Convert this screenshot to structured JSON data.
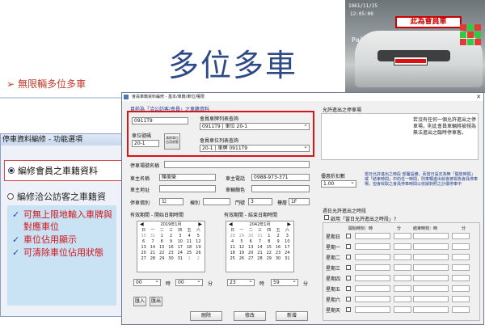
{
  "slide": {
    "title": "多位多車",
    "bullet": "無限輛多位多車"
  },
  "camera": {
    "date": "1961/11/25",
    "time": "12:05:00",
    "paid": "Paid Car",
    "badge": "此為會員車",
    "colors": {
      "grid_red": "#e53935",
      "grid_green": "#2ecc40",
      "badge_red": "#cc0000"
    }
  },
  "func_panel": {
    "title": "停車資料編修 - 功能選項",
    "option1": "編修會員之車籍資料",
    "option2": "編修洽公訪客之車籍資",
    "features": [
      "可無上限地輸入車牌與對應車位",
      "車位佔用顯示",
      "可清除車位佔用狀態"
    ]
  },
  "window": {
    "title": "會員車籍資料編修 - 基本/車籍/車位/權限",
    "close": "✕",
    "header_note": "目前為「洽公訪客/會員」之車籍資料",
    "plate_value": "0911T9",
    "spot_label": "車位號碼",
    "spot_value": "20-1",
    "clear_btn": "清除車位佔用狀態",
    "member_plate_label": "會員車牌列表查詢",
    "member_plate_sel": "0911T9 | 車位 20-1",
    "member_spot_label": "會員車位列表查詢",
    "member_spot_sel": "20-1 | 車牌 0911T9",
    "allowed_label": "允許進出之停車場",
    "hint": "若沒有任何一個允許進出之停車場，則此會員車輛將被視為無法進出之臨時停車客。",
    "parking_name_label": "停車場號名稱",
    "owner_label": "車主名稱",
    "owner_value": "陳美榮",
    "phone_label": "車主電話",
    "phone_value": "0988-973-371",
    "address_label": "車主地址",
    "car_color_label": "車輛顏色",
    "rent_label": "停車價別",
    "rent_value": "公",
    "tower_label": "棟別",
    "door_label": "門號",
    "door_value": "3",
    "floor_label": "樓層",
    "floor_value": "1F",
    "valid_start_label": "有效期間 - 開始日期時間",
    "valid_end_label": "有效期間 - 結束日期時間",
    "cal1_title": "2019年1月",
    "cal2_title": "2042年1月",
    "cal_weekdays": [
      "日",
      "一",
      "二",
      "三",
      "四",
      "五",
      "六"
    ],
    "cal1_days": [
      "30",
      "31",
      "1",
      "2",
      "3",
      "4",
      "5",
      "6",
      "7",
      "8",
      "9",
      "10",
      "11",
      "12",
      "13",
      "14",
      "15",
      "16",
      "17",
      "18",
      "19",
      "20",
      "21",
      "22",
      "23",
      "24",
      "25",
      "26",
      "27",
      "28",
      "29",
      "30",
      "31",
      "1",
      "2"
    ],
    "cal2_days": [
      "28",
      "29",
      "30",
      "31",
      "1",
      "2",
      "3",
      "4",
      "5",
      "6",
      "7",
      "8",
      "9",
      "10",
      "11",
      "12",
      "13",
      "14",
      "15",
      "16",
      "17",
      "18",
      "19",
      "20",
      "21",
      "22",
      "23",
      "24",
      "25",
      "26",
      "27",
      "28",
      "29",
      "30",
      "31"
    ],
    "start_hour": "00",
    "start_min": "00",
    "end_hour": "23",
    "end_min": "59",
    "hour_unit": "時",
    "min_unit": "分",
    "discount_label": "優惠折扣數",
    "discount_value": "1.00",
    "discount_note": "當日允許進出之時段 部屬設備，而當日設定為無「開放時間」或「結束時間」中的任一時間，則車輛進出就會被視為會員停車場，但會收取之會員停車時間以依據對照之計價停車中",
    "weekday_section": "週日允許進出之時段",
    "allow_chk": "啟用「當日允許進出之時段」?",
    "start_col": "開始時刻：時",
    "min_col": "分",
    "end_col": "結束時刻：時",
    "end_min_col": "分",
    "days": [
      "星期日",
      "星期一",
      "星期二",
      "星期三",
      "星期四",
      "星期五",
      "星期六",
      "星期天"
    ],
    "buttons": {
      "import": "匯入",
      "export": "匯出",
      "delete": "刪除",
      "edit": "修改",
      "add": "新增"
    }
  }
}
